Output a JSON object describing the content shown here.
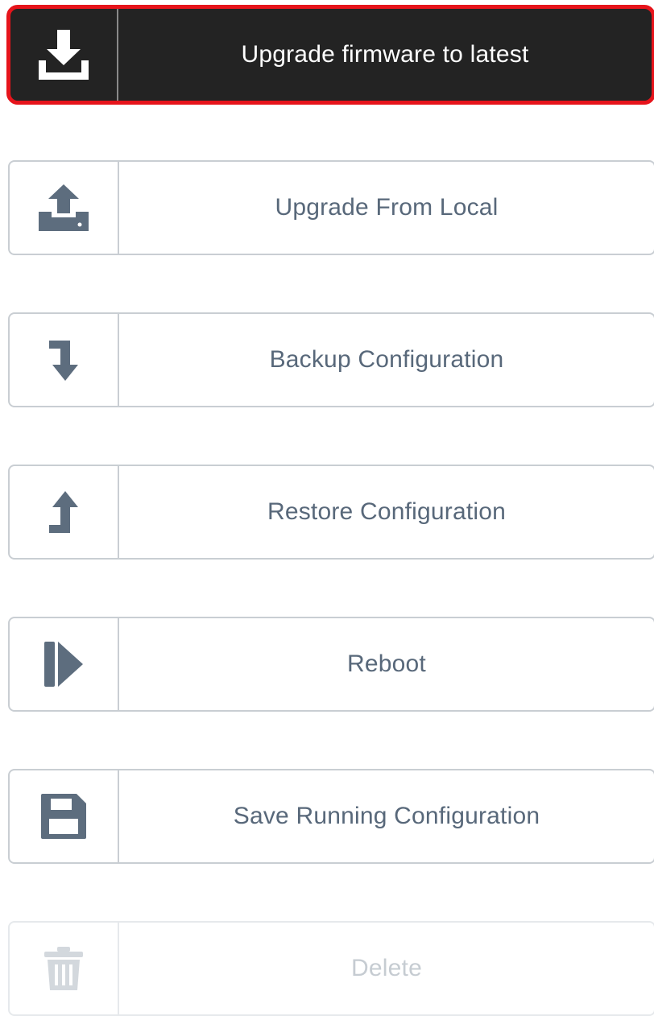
{
  "actions": {
    "upgrade_latest": {
      "label": "Upgrade firmware to latest",
      "icon": "download-icon"
    },
    "upgrade_local": {
      "label": "Upgrade From Local",
      "icon": "upload-icon"
    },
    "backup_config": {
      "label": "Backup Configuration",
      "icon": "arrow-down-turn-icon"
    },
    "restore_config": {
      "label": "Restore Configuration",
      "icon": "arrow-up-turn-icon"
    },
    "reboot": {
      "label": "Reboot",
      "icon": "reboot-icon"
    },
    "save_running": {
      "label": "Save Running Configuration",
      "icon": "floppy-disk-icon"
    },
    "delete": {
      "label": "Delete",
      "icon": "trash-icon",
      "disabled": true
    }
  },
  "colors": {
    "highlight": "#e6141b",
    "primary_bg": "#232323",
    "icon": "#5d6d7e",
    "text": "#58687a",
    "border": "#c9ced3",
    "disabled_text": "#c6ccd2"
  }
}
